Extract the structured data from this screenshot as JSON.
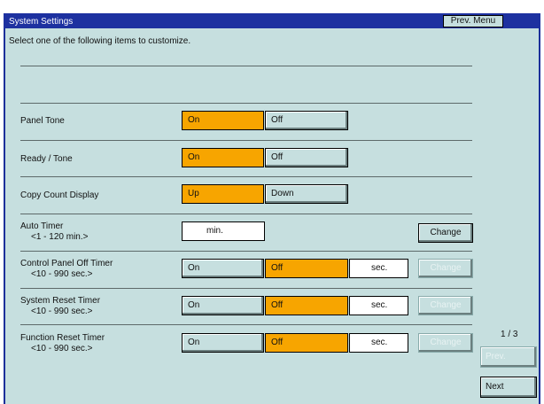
{
  "window": {
    "title": "System Settings",
    "prev_menu_label": "Prev. Menu"
  },
  "instruction": "Select one of the following items to customize.",
  "settings": [
    {
      "label": "Panel Tone",
      "options": [
        "On",
        "Off"
      ],
      "selected": "On"
    },
    {
      "label": "Ready / Tone",
      "options": [
        "On",
        "Off"
      ],
      "selected": "On"
    },
    {
      "label": "Copy Count Display",
      "options": [
        "Up",
        "Down"
      ],
      "selected": "Up"
    },
    {
      "label": "Auto Timer",
      "range": "<1 - 120 min.>",
      "value_unit": "min.",
      "change_label": "Change"
    },
    {
      "label": "Control Panel Off Timer",
      "range": "<10 - 990 sec.>",
      "options": [
        "On",
        "Off"
      ],
      "selected": "Off",
      "value_unit": "sec.",
      "change_label": "Change"
    },
    {
      "label": "System Reset Timer",
      "range": "<10 - 990 sec.>",
      "options": [
        "On",
        "Off"
      ],
      "selected": "Off",
      "value_unit": "sec.",
      "change_label": "Change"
    },
    {
      "label": "Function Reset Timer",
      "range": "<10 - 990 sec.>",
      "options": [
        "On",
        "Off"
      ],
      "selected": "Off",
      "value_unit": "sec.",
      "change_label": "Change"
    }
  ],
  "pagination": {
    "page": "1 / 3",
    "prev_label": "Prev.",
    "next_label": "Next"
  },
  "colors": {
    "title_bar": "#1d31a0",
    "background": "#c6dfdf",
    "selected": "#f7a500"
  }
}
